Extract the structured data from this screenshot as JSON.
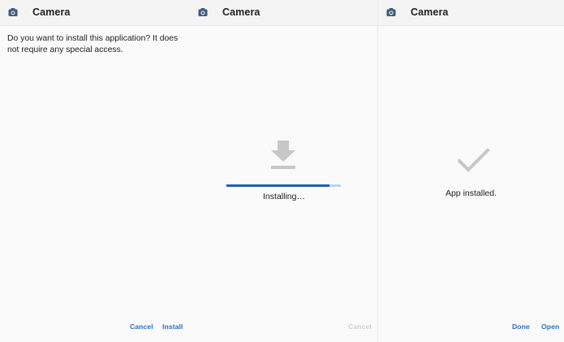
{
  "panels": [
    {
      "header": {
        "title": "Camera",
        "icon": "camera-icon"
      },
      "prompt": "Do you want to install this application? It does not require any special access.",
      "actions": {
        "cancel": "Cancel",
        "install": "Install"
      }
    },
    {
      "header": {
        "title": "Camera",
        "icon": "camera-icon"
      },
      "icon": "download-icon",
      "progress": 0.9,
      "status": "Installing…",
      "actions": {
        "cancel": "Cancel"
      }
    },
    {
      "header": {
        "title": "Camera",
        "icon": "camera-icon"
      },
      "icon": "checkmark-icon",
      "status": "App installed.",
      "actions": {
        "done": "Done",
        "open": "Open"
      }
    }
  ],
  "colors": {
    "accent": "#2b6fc0",
    "progress_fill": "#1e5fb8",
    "progress_track": "#b9d3ef",
    "icon_gray": "#c7c7c7",
    "header_icon": "#3d5a7a"
  }
}
